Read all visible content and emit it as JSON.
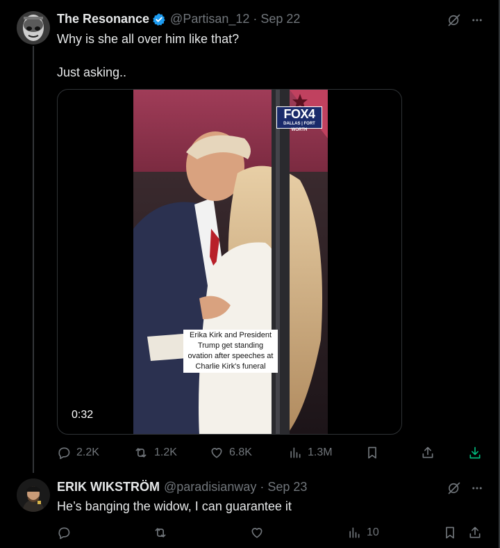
{
  "tweet1": {
    "name": "The Resonance",
    "handle": "@Partisan_12",
    "date": "Sep 22",
    "text_line1": "Why is she all over him like that?",
    "text_line2": "Just asking..",
    "media": {
      "duration": "0:32",
      "network_logo": "FOX4",
      "network_sub": "DALLAS | FORT WORTH",
      "caption": "Erika Kirk and President Trump get standing ovation after speeches at Charlie Kirk's funeral"
    },
    "actions": {
      "replies": "2.2K",
      "reposts": "1.2K",
      "likes": "6.8K",
      "views": "1.3M"
    },
    "accent": "#1d9bf0"
  },
  "tweet2": {
    "name": "ERIK WIKSTRÖM",
    "handle": "@paradisianway",
    "date": "Sep 23",
    "text": "He’s banging the widow, I can guarantee it",
    "actions": {
      "views": "10"
    }
  },
  "colors": {
    "background": "#000000",
    "text": "#e7e9ea",
    "muted": "#71767b",
    "download_accent": "#00ba7c"
  }
}
